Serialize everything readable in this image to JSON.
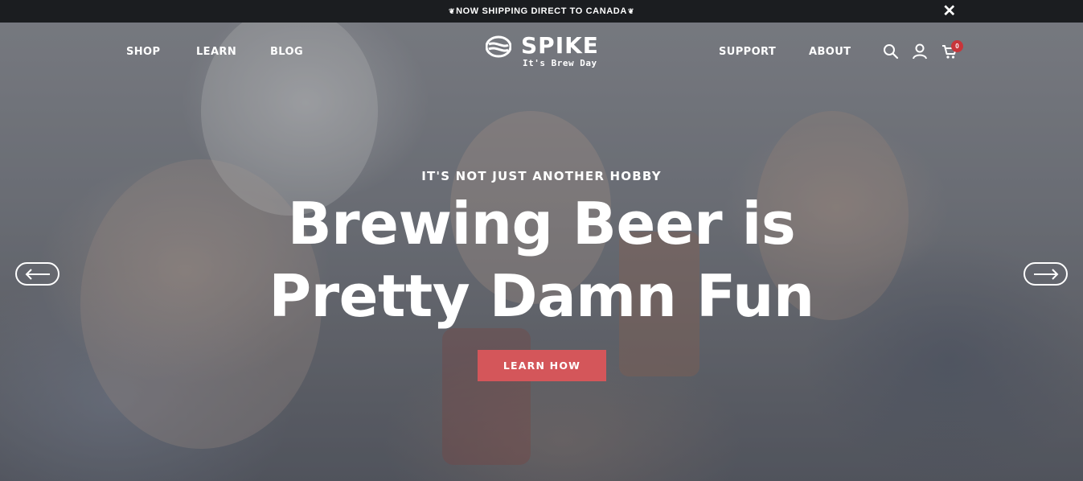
{
  "announcement": {
    "text": "NOW SHIPPING DIRECT TO CANADA",
    "close_icon": "close-icon",
    "flag_icon": "maple-leaf-icon"
  },
  "nav": {
    "left": [
      {
        "label": "SHOP"
      },
      {
        "label": "LEARN"
      },
      {
        "label": "BLOG"
      }
    ],
    "right": [
      {
        "label": "SUPPORT"
      },
      {
        "label": "ABOUT"
      }
    ],
    "icons": [
      "search-icon",
      "account-icon",
      "cart-icon"
    ],
    "cart_count": "0"
  },
  "logo": {
    "name": "SPIKE",
    "tagline": "It's Brew Day"
  },
  "hero": {
    "eyebrow": "IT'S NOT JUST ANOTHER HOBBY",
    "headline_line1": "Brewing Beer is",
    "headline_line2": "Pretty Damn Fun",
    "cta_label": "LEARN HOW",
    "prev_icon": "arrow-left-icon",
    "next_icon": "arrow-right-icon"
  },
  "colors": {
    "announcement_bg": "#1b1d20",
    "cta_bg": "#d4565a",
    "badge_bg": "#c8353a"
  }
}
